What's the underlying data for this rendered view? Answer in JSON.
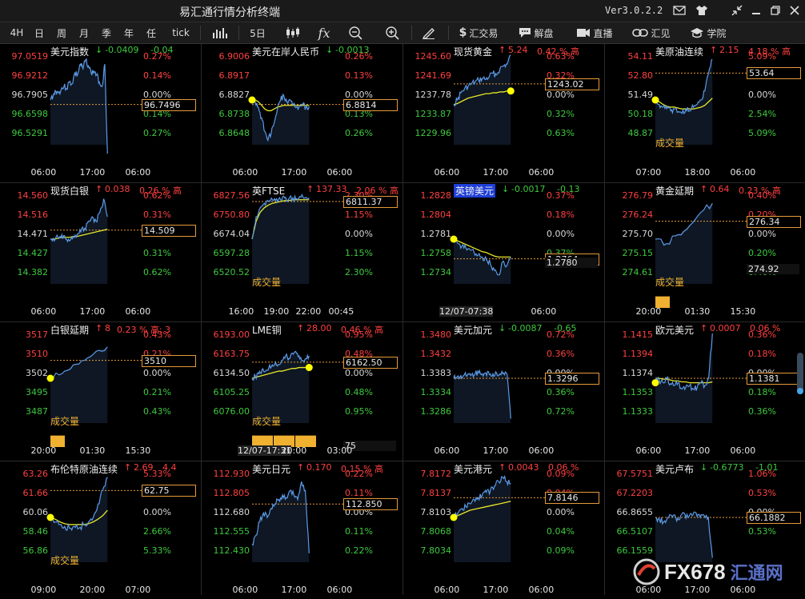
{
  "window": {
    "title": "易汇通行情分析终端",
    "version": "Ver3.0.2.2"
  },
  "toolbar": {
    "periods": [
      "4H",
      "日",
      "周",
      "月",
      "季",
      "年",
      "任",
      "tick"
    ],
    "minute": "5日",
    "trade": "汇交易",
    "analysis": "解盘",
    "live": "直播",
    "insight": "汇见",
    "academy": "学院",
    "icons": [
      "bar-chart-icon",
      "candles-icon",
      "fx-icon",
      "zoom-out-icon",
      "zoom-in-icon",
      "pen-icon",
      "dollar-icon",
      "chat-icon",
      "video-icon",
      "link-icon",
      "graduation-icon"
    ]
  },
  "colors": {
    "up": "#ff4040",
    "down": "#3ec93e",
    "flat": "#d8d8d8",
    "line": "#5b9be8",
    "avg": "#e8e62a",
    "box": "#e69a3a",
    "vol": "#f0b030"
  },
  "watermark": {
    "logo": "FX678",
    "text": "汇通网"
  },
  "panels": [
    {
      "name": "美元指数",
      "arrow": "↓",
      "change": "-0.0409",
      "pct": "-0.04",
      "highlight": false,
      "yl": [
        "97.0519",
        "96.9212",
        "96.7905",
        "96.6598",
        "96.5291"
      ],
      "yl_colors": [
        "up",
        "up",
        "flat",
        "down",
        "down"
      ],
      "yr": [
        "0.27%",
        "0.14%",
        "0.00%",
        "0.14%",
        "0.27%"
      ],
      "yr_colors": [
        "up",
        "up",
        "flat",
        "down",
        "down"
      ],
      "xt": [
        "06:00",
        "17:00",
        "06:00"
      ],
      "box": "96.7496",
      "box2": null,
      "vol_label": null,
      "vol": [],
      "price": [
        0.5,
        0.45,
        0.4,
        0.42,
        0.38,
        0.35,
        0.37,
        0.3,
        0.32,
        0.2,
        0.22,
        0.1,
        0.15,
        0.05,
        0.12,
        0.2,
        0.18,
        0.22,
        0.3,
        0.35,
        0.1,
        1.1
      ],
      "avg": [],
      "dot": null,
      "dash_y": 0.55
    },
    {
      "name": "美元在岸人民币",
      "arrow": "↓",
      "change": "-0.0013",
      "pct": "",
      "highlight": false,
      "yl": [
        "6.9006",
        "6.8917",
        "6.8827",
        "6.8738",
        "6.8648"
      ],
      "yl_colors": [
        "up",
        "up",
        "flat",
        "down",
        "down"
      ],
      "yr": [
        "0.26%",
        "0.13%",
        "0.00%",
        "0.13%",
        "0.26%"
      ],
      "yr_colors": [
        "up",
        "up",
        "flat",
        "down",
        "down"
      ],
      "xt": [
        "06:00",
        "17:00",
        "06:00"
      ],
      "box": "6.8814",
      "box2": null,
      "vol_label": null,
      "vol": [],
      "price": [
        0.5,
        0.52,
        0.58,
        0.7,
        0.85,
        0.95,
        0.88,
        0.75,
        0.6,
        0.5,
        0.45,
        0.52,
        0.5,
        0.55,
        0.58,
        0.56,
        0.55,
        0.58,
        0.57
      ],
      "avg": [
        0.5,
        0.5,
        0.52,
        0.56,
        0.6,
        0.62,
        0.62,
        0.6,
        0.58,
        0.57,
        0.56,
        0.56,
        0.56,
        0.56,
        0.56,
        0.56,
        0.56,
        0.56,
        0.56
      ],
      "dot": 0.5,
      "dash_y": 0.55
    },
    {
      "name": "现货黄金",
      "arrow": "↑",
      "change": "5.24",
      "pct": "0.42 %  高",
      "highlight": false,
      "yl": [
        "1245.60",
        "1241.69",
        "1237.78",
        "1233.87",
        "1229.96"
      ],
      "yl_colors": [
        "up",
        "up",
        "flat",
        "down",
        "down"
      ],
      "yr": [
        "0.63%",
        "0.32%",
        "0.00%",
        "0.32%",
        "0.63%"
      ],
      "yr_colors": [
        "up",
        "up",
        "flat",
        "down",
        "down"
      ],
      "xt": [
        "06:00",
        "17:00",
        "06:00"
      ],
      "box": "1243.02",
      "box2": null,
      "vol_label": null,
      "vol": [],
      "price": [
        0.55,
        0.5,
        0.42,
        0.38,
        0.35,
        0.32,
        0.3,
        0.28,
        0.26,
        0.27,
        0.24,
        0.2,
        0.22,
        0.15,
        0.12,
        0.1,
        0.0
      ],
      "avg": [
        0.55,
        0.54,
        0.52,
        0.5,
        0.48,
        0.47,
        0.46,
        0.45,
        0.44,
        0.43,
        0.43,
        0.42,
        0.42,
        0.41,
        0.41,
        0.4,
        0.4
      ],
      "dot": 0.4,
      "dash_y": 0.32
    },
    {
      "name": "美原油连续",
      "arrow": "↑",
      "change": "2.15",
      "pct": "4.18 %  高",
      "highlight": false,
      "yl": [
        "54.11",
        "52.80",
        "51.49",
        "50.18",
        "48.87"
      ],
      "yl_colors": [
        "up",
        "up",
        "flat",
        "down",
        "down"
      ],
      "yr": [
        "5.09%",
        "2.54%",
        "0.00%",
        "2.54%",
        "5.09%"
      ],
      "yr_colors": [
        "up",
        "up",
        "flat",
        "down",
        "down"
      ],
      "xt": [
        "07:00",
        "18:00",
        "06:00"
      ],
      "box": "53.64",
      "box2": null,
      "vol_label": "成交量",
      "vol": [],
      "price": [
        0.5,
        0.55,
        0.58,
        0.6,
        0.62,
        0.6,
        0.63,
        0.65,
        0.6,
        0.62,
        0.58,
        0.55,
        0.5,
        0.4,
        0.2,
        0.05
      ],
      "avg": [
        0.5,
        0.52,
        0.55,
        0.57,
        0.58,
        0.58,
        0.59,
        0.6,
        0.6,
        0.6,
        0.6,
        0.59,
        0.58,
        0.56,
        0.52,
        0.48
      ],
      "dot": 0.5,
      "dash_y": 0.2
    },
    {
      "name": "现货白银",
      "arrow": "↑",
      "change": "0.038",
      "pct": "0.26 %  高",
      "highlight": false,
      "yl": [
        "14.560",
        "14.516",
        "14.471",
        "14.427",
        "14.382"
      ],
      "yl_colors": [
        "up",
        "up",
        "flat",
        "down",
        "down"
      ],
      "yr": [
        "0.62%",
        "0.31%",
        "0.00%",
        "0.31%",
        "0.62%"
      ],
      "yr_colors": [
        "up",
        "up",
        "flat",
        "down",
        "down"
      ],
      "xt": [
        "06:00",
        "17:00",
        "06:00"
      ],
      "box": "14.509",
      "box2": null,
      "vol_label": null,
      "vol": [],
      "price": [
        0.5,
        0.52,
        0.48,
        0.45,
        0.5,
        0.52,
        0.47,
        0.45,
        0.42,
        0.38,
        0.3,
        0.25,
        0.3,
        0.2,
        0.05,
        0.25
      ],
      "avg": [
        0.5,
        0.5,
        0.49,
        0.48,
        0.48,
        0.48,
        0.47,
        0.47,
        0.46,
        0.45,
        0.44,
        0.43,
        0.42,
        0.41,
        0.4,
        0.39
      ],
      "dot": null,
      "dash_y": 0.4
    },
    {
      "name": "英FTSE",
      "arrow": "↑",
      "change": "137.33",
      "pct": "2.06 %  高",
      "highlight": false,
      "yl": [
        "6827.56",
        "6750.80",
        "6674.04",
        "6597.28",
        "6520.52"
      ],
      "yl_colors": [
        "up",
        "up",
        "flat",
        "down",
        "down"
      ],
      "yr": [
        "2.30%",
        "1.15%",
        "0.00%",
        "1.15%",
        "2.30%"
      ],
      "yr_colors": [
        "up",
        "up",
        "flat",
        "down",
        "down"
      ],
      "xt": [
        "16:00",
        "19:00",
        "22:00",
        "00:45"
      ],
      "box": "6811.37",
      "box2": null,
      "vol_label": "成交量",
      "vol": [],
      "price": [
        0.5,
        0.25,
        0.15,
        0.1,
        0.08,
        0.06,
        0.05,
        0.06,
        0.04,
        0.05,
        0.04,
        0.05,
        0.03,
        0.04,
        0.04
      ],
      "avg": [
        0.5,
        0.3,
        0.2,
        0.15,
        0.12,
        0.1,
        0.09,
        0.08,
        0.07,
        0.07,
        0.06,
        0.06,
        0.06,
        0.06,
        0.06
      ],
      "dot": null,
      "dash_y": 0.08
    },
    {
      "name": "英镑美元",
      "arrow": "↓",
      "change": "-0.0017",
      "pct": "-0.13",
      "highlight": true,
      "yl": [
        "1.2828",
        "1.2804",
        "1.2781",
        "1.2758",
        "1.2734"
      ],
      "yl_colors": [
        "up",
        "up",
        "flat",
        "down",
        "down"
      ],
      "yr": [
        "0.37%",
        "0.18%",
        "0.00%",
        "0.37%",
        ""
      ],
      "yr_colors": [
        "up",
        "up",
        "flat",
        "down",
        "down"
      ],
      "xt": [
        "12/07-07:38",
        "06:00"
      ],
      "box": "1.2764",
      "box2": "1.2780",
      "vol_label": null,
      "vol": [],
      "price": [
        0.5,
        0.55,
        0.58,
        0.6,
        0.62,
        0.65,
        0.68,
        0.7,
        0.72,
        0.78,
        0.85,
        0.9,
        0.75,
        0.8,
        0.7
      ],
      "avg": [
        0.5,
        0.52,
        0.54,
        0.56,
        0.58,
        0.6,
        0.62,
        0.64,
        0.65,
        0.67,
        0.69,
        0.7,
        0.7,
        0.7,
        0.7
      ],
      "dot": 0.5,
      "dash_y": 0.72
    },
    {
      "name": "黄金延期",
      "arrow": "↑",
      "change": "0.64",
      "pct": "0.23 %  高",
      "highlight": false,
      "yl": [
        "276.79",
        "276.24",
        "275.70",
        "275.15",
        "274.61"
      ],
      "yl_colors": [
        "up",
        "up",
        "flat",
        "down",
        "down"
      ],
      "yr": [
        "0.40%",
        "0.20%",
        "0.00%",
        "0.20%",
        "0.40%"
      ],
      "yr_colors": [
        "up",
        "up",
        "flat",
        "down",
        "down"
      ],
      "xt": [
        "20:00",
        "01:30",
        "15:30"
      ],
      "box": "276.34",
      "box2": "274.92",
      "vol_label": "成交量",
      "vol": [
        0.9
      ],
      "price": [
        0.5,
        0.55,
        0.45,
        0.35,
        0.2,
        0.1
      ],
      "avg": [],
      "dot": null,
      "dash_y": 0.3
    },
    {
      "name": "白银延期",
      "arrow": "↑",
      "change": "8",
      "pct": "0.23 %  高: 3",
      "highlight": false,
      "yl": [
        "3517",
        "3510",
        "3502",
        "3495",
        "3487"
      ],
      "yl_colors": [
        "up",
        "up",
        "flat",
        "down",
        "down"
      ],
      "yr": [
        "0.43%",
        "0.21%",
        "0.00%",
        "0.21%",
        "0.43%"
      ],
      "yr_colors": [
        "up",
        "up",
        "flat",
        "down",
        "down"
      ],
      "xt": [
        "20:00",
        "01:30",
        "15:30"
      ],
      "box": "3510",
      "box2": null,
      "vol_label": "成交量",
      "vol": [
        0.9
      ],
      "price": [
        0.5,
        0.45,
        0.35,
        0.3,
        0.2,
        0.15
      ],
      "avg": [],
      "dot": 0.5,
      "dash_y": 0.3
    },
    {
      "name": "LME铜",
      "arrow": "↑",
      "change": "28.00",
      "pct": "0.46 %  高",
      "highlight": false,
      "yl": [
        "6193.00",
        "6163.75",
        "6134.50",
        "6105.25",
        "6076.00"
      ],
      "yl_colors": [
        "up",
        "up",
        "flat",
        "down",
        "down"
      ],
      "yr": [
        "0.95%",
        "0.48%",
        "0.00%",
        "0.48%",
        "0.95%"
      ],
      "yr_colors": [
        "up",
        "up",
        "flat",
        "down",
        "down"
      ],
      "xt": [
        "12/07-17:31",
        "20:00",
        "03:00"
      ],
      "box": "6162.50",
      "box2": "75",
      "vol_label": "成交量",
      "vol": [
        0.9,
        0.9,
        0.9
      ],
      "price": [
        0.5,
        0.48,
        0.45,
        0.4,
        0.42,
        0.38,
        0.35,
        0.32,
        0.35,
        0.3,
        0.25,
        0.28,
        0.22,
        0.2,
        0.25,
        0.3,
        0.28,
        0.25
      ],
      "avg": [
        0.5,
        0.49,
        0.48,
        0.47,
        0.46,
        0.45,
        0.44,
        0.43,
        0.42,
        0.42,
        0.41,
        0.4,
        0.39,
        0.39,
        0.38,
        0.38,
        0.38,
        0.38
      ],
      "dot": 0.38,
      "dash_y": 0.32
    },
    {
      "name": "美元加元",
      "arrow": "↓",
      "change": "-0.0087",
      "pct": "-0.65",
      "highlight": false,
      "yl": [
        "1.3480",
        "1.3432",
        "1.3383",
        "1.3334",
        "1.3286"
      ],
      "yl_colors": [
        "up",
        "up",
        "flat",
        "down",
        "down"
      ],
      "yr": [
        "0.72%",
        "0.36%",
        "0.00%",
        "0.36%",
        "0.72%"
      ],
      "yr_colors": [
        "up",
        "up",
        "flat",
        "down",
        "down"
      ],
      "xt": [
        "06:00",
        "17:00",
        "06:00"
      ],
      "box": "1.3296",
      "box2": null,
      "vol_label": null,
      "vol": [],
      "price": [
        0.5,
        0.48,
        0.47,
        0.46,
        0.45,
        0.46,
        0.45,
        0.44,
        0.45,
        0.44,
        0.46,
        0.45,
        0.44,
        0.45,
        0.44,
        0.46,
        0.95
      ],
      "avg": [],
      "dot": null,
      "dash_y": 0.5
    },
    {
      "name": "欧元美元",
      "arrow": "↑",
      "change": "0.0007",
      "pct": "0.06 %",
      "highlight": false,
      "yl": [
        "1.1415",
        "1.1394",
        "1.1374",
        "1.1353",
        "1.1333"
      ],
      "yl_colors": [
        "up",
        "up",
        "flat",
        "down",
        "down"
      ],
      "yr": [
        "0.36%",
        "0.18%",
        "0.00%",
        "0.18%",
        "0.36%"
      ],
      "yr_colors": [
        "up",
        "up",
        "flat",
        "down",
        "down"
      ],
      "xt": [
        "06:00",
        "17:00",
        "06:00"
      ],
      "box": "1.1381",
      "box2": null,
      "vol_label": null,
      "vol": [],
      "price": [
        0.5,
        0.52,
        0.55,
        0.5,
        0.56,
        0.58,
        0.55,
        0.62,
        0.6,
        0.58,
        0.62,
        0.6,
        0.55,
        0.58,
        0.5,
        0.0
      ],
      "avg": [
        0.5,
        0.5,
        0.51,
        0.51,
        0.52,
        0.53,
        0.53,
        0.54,
        0.54,
        0.55,
        0.55,
        0.55,
        0.55,
        0.55,
        0.55,
        0.54
      ],
      "dot": 0.55,
      "dash_y": 0.5
    },
    {
      "name": "布伦特原油连续",
      "arrow": "↑",
      "change": "2.69",
      "pct": "4.4",
      "highlight": false,
      "yl": [
        "63.26",
        "61.66",
        "60.06",
        "58.46",
        "56.86"
      ],
      "yl_colors": [
        "up",
        "up",
        "flat",
        "down",
        "down"
      ],
      "yr": [
        "5.33%",
        "2.66%",
        "0.00%",
        "2.66%",
        "5.33%"
      ],
      "yr_colors": [
        "up",
        "up",
        "flat",
        "down",
        "down"
      ],
      "xt": [
        "09:00",
        "20:00",
        "07:00"
      ],
      "box": "62.75",
      "box2": null,
      "vol_label": "成交量",
      "vol": [],
      "price": [
        0.5,
        0.55,
        0.58,
        0.6,
        0.62,
        0.6,
        0.62,
        0.58,
        0.55,
        0.5,
        0.35,
        0.2,
        0.05
      ],
      "avg": [
        0.5,
        0.52,
        0.55,
        0.57,
        0.58,
        0.58,
        0.58,
        0.58,
        0.57,
        0.55,
        0.52,
        0.48,
        0.42
      ],
      "dot": 0.5,
      "dash_y": 0.2
    },
    {
      "name": "美元日元",
      "arrow": "↑",
      "change": "0.170",
      "pct": "0.15 %  高",
      "highlight": false,
      "yl": [
        "112.930",
        "112.805",
        "112.680",
        "112.555",
        "112.430"
      ],
      "yl_colors": [
        "up",
        "up",
        "flat",
        "down",
        "down"
      ],
      "yr": [
        "0.22%",
        "0.11%",
        "0.00%",
        "0.11%",
        "0.22%"
      ],
      "yr_colors": [
        "up",
        "up",
        "flat",
        "down",
        "down"
      ],
      "xt": [
        "06:00",
        "17:00",
        "06:00"
      ],
      "box": "112.850",
      "box2": null,
      "vol_label": null,
      "vol": [],
      "price": [
        0.8,
        0.7,
        0.55,
        0.45,
        0.5,
        0.4,
        0.35,
        0.3,
        0.25,
        0.28,
        0.2,
        0.25,
        0.3,
        0.1,
        0.2,
        0.9
      ],
      "avg": [],
      "dot": null,
      "dash_y": 0.35
    },
    {
      "name": "美元港元",
      "arrow": "↑",
      "change": "0.0043",
      "pct": "0.06 %",
      "highlight": false,
      "yl": [
        "7.8172",
        "7.8137",
        "7.8103",
        "7.8068",
        "7.8034"
      ],
      "yl_colors": [
        "up",
        "up",
        "flat",
        "down",
        "down"
      ],
      "yr": [
        "0.09%",
        "0.04%",
        "0.00%",
        "0.04%",
        "0.09%"
      ],
      "yr_colors": [
        "up",
        "up",
        "flat",
        "down",
        "down"
      ],
      "xt": [
        "06:00",
        "17:00",
        "06:00"
      ],
      "box": "7.8146",
      "box2": null,
      "vol_label": null,
      "vol": [],
      "price": [
        0.5,
        0.45,
        0.4,
        0.38,
        0.35,
        0.3,
        0.28,
        0.25,
        0.22,
        0.2,
        0.15,
        0.1,
        0.05,
        0.1,
        0.12
      ],
      "avg": [
        0.5,
        0.48,
        0.46,
        0.44,
        0.42,
        0.41,
        0.4,
        0.39,
        0.38,
        0.37,
        0.36,
        0.35,
        0.34,
        0.33,
        0.32
      ],
      "dot": 0.5,
      "dash_y": 0.28
    },
    {
      "name": "美元卢布",
      "arrow": "↓",
      "change": "-0.6773",
      "pct": "-1.01",
      "highlight": false,
      "yl": [
        "67.5751",
        "67.2203",
        "66.8655",
        "66.5107",
        "66.1559"
      ],
      "yl_colors": [
        "up",
        "up",
        "flat",
        "down",
        "down"
      ],
      "yr": [
        "1.06%",
        "0.53%",
        "0.00%",
        "0.53%",
        ""
      ],
      "yr_colors": [
        "up",
        "up",
        "flat",
        "down",
        "down"
      ],
      "xt": [
        "06:00",
        "17:00",
        "06:00"
      ],
      "box": "66.1882",
      "box2": null,
      "vol_label": null,
      "vol": [],
      "price": [
        0.5,
        0.52,
        0.55,
        0.5,
        0.48,
        0.5,
        0.52,
        0.45,
        0.5,
        0.48,
        0.45,
        0.5,
        0.48,
        0.5,
        0.95
      ],
      "avg": [],
      "dot": null,
      "dash_y": 0.5
    }
  ]
}
